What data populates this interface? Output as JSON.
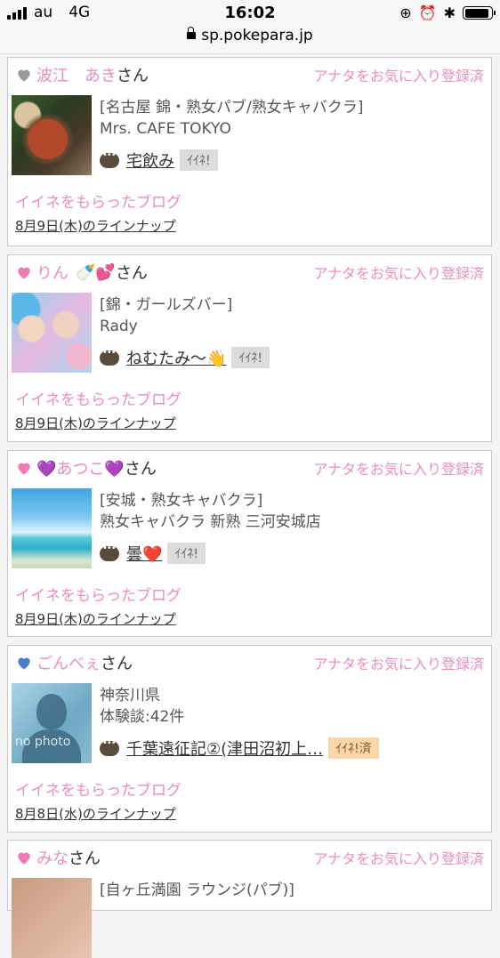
{
  "status": {
    "carrier": "au",
    "network": "4G",
    "time": "16:02",
    "battery": 0.95
  },
  "urlbar": {
    "url": "sp.pokepara.jp"
  },
  "common": {
    "fav_label": "アナタをお気に入り登録済",
    "san": "さん",
    "blog_link": "イイネをもらったブログ"
  },
  "cards": [
    {
      "name": "波江　あき",
      "heart_color": "#9a9a9a",
      "emoji": "",
      "line1": "[名古屋 錦・熟女パブ/熟女キャバクラ]",
      "line2": "Mrs. CAFE TOKYO",
      "blog_title": "宅飲み",
      "iine": "ｲｲﾈ!",
      "lineup": "8月9日(木)のラインナップ"
    },
    {
      "name": "りん",
      "heart_color": "#f07ab6",
      "emoji": "🍼💕",
      "line1": "[錦・ガールズバー]",
      "line2": "Rady",
      "blog_title": "ねむたみ〜👋",
      "iine": "ｲｲﾈ!",
      "lineup": "8月9日(木)のラインナップ"
    },
    {
      "name": "💜あつこ💜",
      "heart_color": "#f07ab6",
      "emoji": "",
      "line1": "[安城・熟女キャバクラ]",
      "line2": "熟女キャバクラ 新熟 三河安城店",
      "blog_title": "曇❤️",
      "iine": "ｲｲﾈ!",
      "lineup": "8月9日(木)のラインナップ"
    },
    {
      "name": "ごんべぇ",
      "heart_color": "#4a7fc8",
      "emoji": "",
      "line1": "神奈川県",
      "line2": "体験談:42件",
      "blog_title": "千葉遠征記②(津田沼初上…",
      "iine": "ｲｲﾈ!済",
      "lineup": "8月8日(水)のラインナップ",
      "thumb_text": "no photo"
    },
    {
      "name": "みな",
      "heart_color": "#f07ab6",
      "emoji": "",
      "line1": "[自ヶ丘満園 ラウンジ(パブ)]"
    }
  ]
}
